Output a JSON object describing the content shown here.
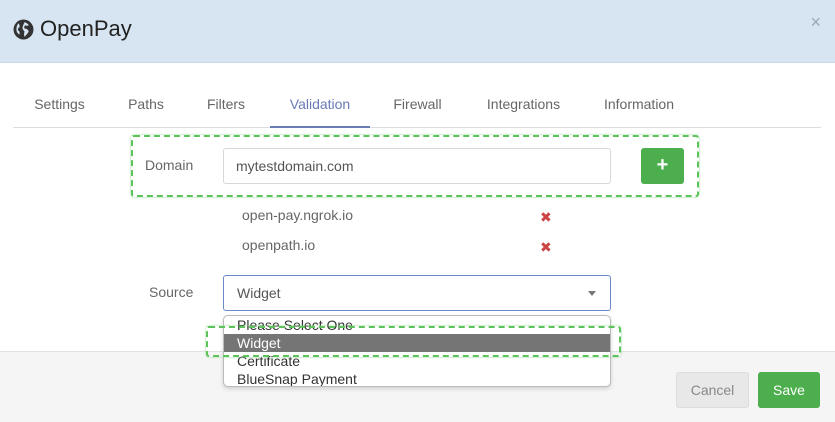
{
  "header": {
    "title": "OpenPay",
    "icon": "globe-icon",
    "close_label": "×"
  },
  "tabs": [
    {
      "label": "Settings"
    },
    {
      "label": "Paths"
    },
    {
      "label": "Filters"
    },
    {
      "label": "Validation",
      "active": true
    },
    {
      "label": "Firewall"
    },
    {
      "label": "Integrations"
    },
    {
      "label": "Information"
    }
  ],
  "domain": {
    "label": "Domain",
    "value": "mytestdomain.com",
    "add_label": "+",
    "items": [
      {
        "text": "open-pay.ngrok.io",
        "remove_label": "✖"
      },
      {
        "text": "openpath.io",
        "remove_label": "✖"
      }
    ]
  },
  "source": {
    "label": "Source",
    "selected": "Widget",
    "options": [
      "Please Select One",
      "Widget",
      "Certificate",
      "BlueSnap Payment"
    ]
  },
  "footer": {
    "cancel_label": "Cancel",
    "save_label": "Save"
  },
  "colors": {
    "header_bg": "#d7e5f2",
    "accent": "#6a7bb5",
    "success": "#4cae4c",
    "danger": "#cc4444",
    "highlight": "#5cc35c"
  }
}
